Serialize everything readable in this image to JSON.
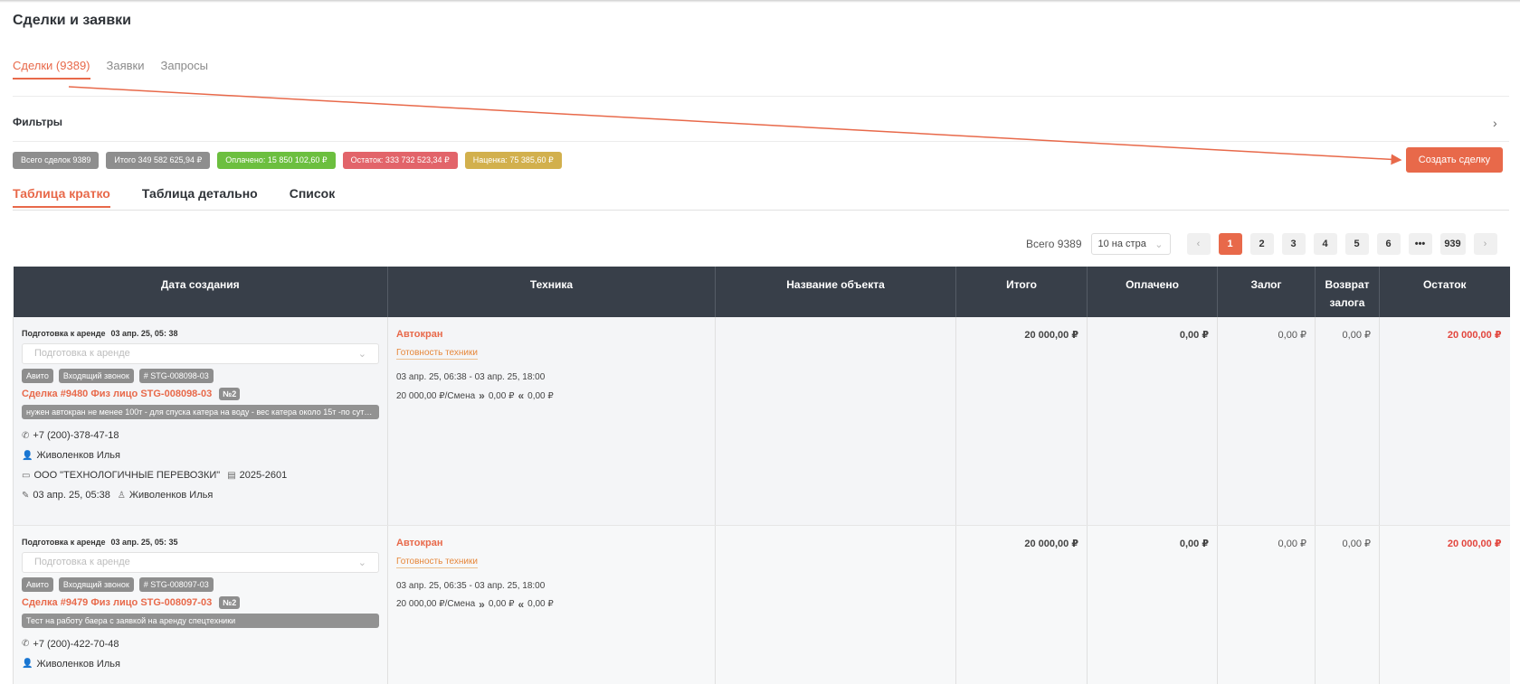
{
  "page": {
    "title": "Сделки и заявки"
  },
  "top_tabs": [
    {
      "label": "Сделки (9389)",
      "active": true
    },
    {
      "label": "Заявки",
      "active": false
    },
    {
      "label": "Запросы",
      "active": false
    }
  ],
  "filters": {
    "label": "Фильтры",
    "icon": "chevron-right-icon"
  },
  "chips": {
    "total_deals": "Всего сделок 9389",
    "total_sum": "Итого 349 582 625,94 ₽",
    "paid": "Оплачено: 15 850 102,60 ₽",
    "remaining": "Остаток: 333 732 523,34 ₽",
    "markup": "Наценка: 75 385,60 ₽"
  },
  "create_button": "Создать сделку",
  "view_tabs": [
    {
      "label": "Таблица кратко",
      "active": true
    },
    {
      "label": "Таблица детально",
      "active": false
    },
    {
      "label": "Список",
      "active": false
    }
  ],
  "pagination": {
    "total": "Всего 9389",
    "per_page": "10 на стра",
    "pages": [
      "1",
      "2",
      "3",
      "4",
      "5",
      "6",
      "•••",
      "939"
    ],
    "current": "1"
  },
  "table": {
    "headers": [
      "Дата создания",
      "Техника",
      "Название объекта",
      "Итого",
      "Оплачено",
      "Залог",
      "Возврат залога",
      "Остаток"
    ],
    "rows": [
      {
        "status": "Подготовка к аренде",
        "status_date": "03 апр. 25, 05: 38",
        "select_placeholder": "Подготовка к аренде",
        "tags": [
          "Авито",
          "Входящий звонок",
          "# STG-008098-03"
        ],
        "title": "Сделка #9480 Физ лицо STG-008098-03",
        "badge": "№2",
        "comment": "нужен автокран не менее 100т - для спуска катера на воду - вес катера около 15т -по сути ...",
        "phone": "+7 (200)-378-47-18",
        "manager": "Живоленков Илья",
        "company": "ООО \"ТЕХНОЛОГИЧНЫЕ ПЕРЕВОЗКИ\"",
        "doc": "2025-2601",
        "edited": "03 апр. 25, 05:38",
        "editor": "Живоленков Илья",
        "tech_name": "Автокран",
        "tech_status": "Готовность техники",
        "tech_period": "03 апр. 25, 06:38 - 03 апр. 25, 18:00",
        "tech_rate": "20 000,00 ₽/Смена",
        "tech_in": "0,00 ₽",
        "tech_out": "0,00 ₽",
        "object": "",
        "total": "20 000,00 ₽",
        "paid": "0,00 ₽",
        "deposit": "0,00 ₽",
        "deposit_return": "0,00 ₽",
        "remaining": "20 000,00 ₽"
      },
      {
        "status": "Подготовка к аренде",
        "status_date": "03 апр. 25, 05: 35",
        "select_placeholder": "Подготовка к аренде",
        "tags": [
          "Авито",
          "Входящий звонок",
          "# STG-008097-03"
        ],
        "title": "Сделка #9479 Физ лицо STG-008097-03",
        "badge": "№2",
        "comment": "Тест на работу баера с заявкой на аренду спецтехники",
        "phone": "+7 (200)-422-70-48",
        "manager": "Живоленков Илья",
        "tech_name": "Автокран",
        "tech_status": "Готовность техники",
        "tech_period": "03 апр. 25, 06:35 - 03 апр. 25, 18:00",
        "tech_rate": "20 000,00 ₽/Смена",
        "tech_in": "0,00 ₽",
        "tech_out": "0,00 ₽",
        "object": "",
        "total": "20 000,00 ₽",
        "paid": "0,00 ₽",
        "deposit": "0,00 ₽",
        "deposit_return": "0,00 ₽",
        "remaining": "20 000,00 ₽"
      }
    ]
  },
  "colors": {
    "accent": "#e8694a",
    "header_bg": "#383f49",
    "chip_gray": "#8e8e8e",
    "chip_green": "#6cbf3f",
    "chip_red": "#e2646a",
    "chip_yellow": "#d2b04d",
    "remaining_red": "#e2453d"
  }
}
